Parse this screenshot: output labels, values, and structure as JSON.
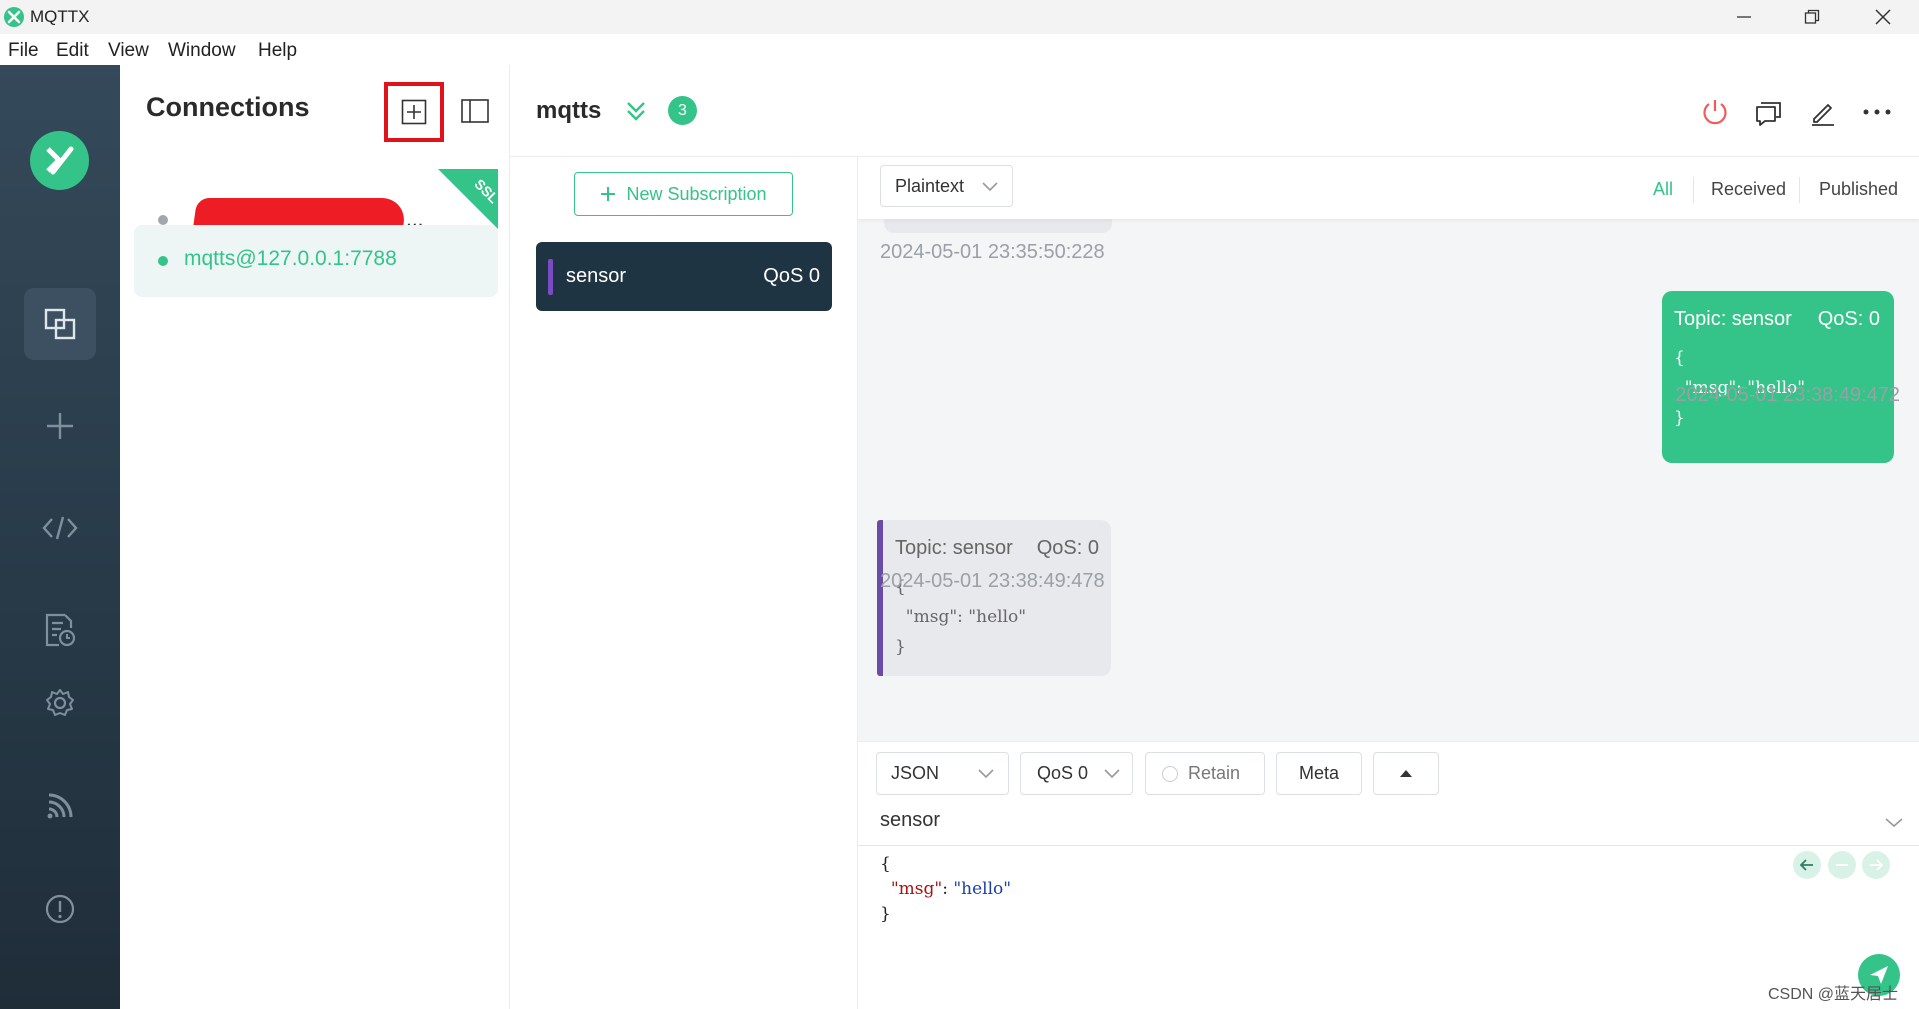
{
  "window": {
    "title": "MQTTX"
  },
  "menu": [
    "File",
    "Edit",
    "View",
    "Window",
    "Help"
  ],
  "connections": {
    "title": "Connections",
    "items": [
      {
        "label": "...",
        "status": "disconnected",
        "ssl_badge": "SSL"
      },
      {
        "label": "mqtts@127.0.0.1:7788",
        "status": "connected"
      }
    ]
  },
  "header": {
    "connection_name": "mqtts",
    "badge_count": "3"
  },
  "subscriptions": {
    "new_button": "New Subscription",
    "items": [
      {
        "topic": "sensor",
        "qos": "QoS 0"
      }
    ]
  },
  "messages": {
    "format": "Plaintext",
    "filters": [
      "All",
      "Received",
      "Published"
    ],
    "active_filter": "All",
    "list": [
      {
        "type": "timestamp-only",
        "time": "2024-05-01 23:35:50:228"
      },
      {
        "type": "published",
        "topic": "Topic: sensor",
        "qos": "QoS: 0",
        "payload": "{\n  \"msg\": \"hello\"\n}",
        "time": "2024-05-01 23:38:49:472"
      },
      {
        "type": "received",
        "topic": "Topic: sensor",
        "qos": "QoS: 0",
        "payload": "{\n  \"msg\": \"hello\"\n}",
        "time": "2024-05-01 23:38:49:478"
      }
    ]
  },
  "publish": {
    "format": "JSON",
    "qos": "QoS 0",
    "retain_label": "Retain",
    "meta_label": "Meta",
    "topic": "sensor",
    "payload": {
      "open": "{",
      "key": "\"msg\"",
      "sep": ": ",
      "value": "\"hello\"",
      "close": "}"
    }
  },
  "watermark": "CSDN @蓝天居士",
  "colors": {
    "accent": "#34c388",
    "nav_bg": "#2c3e4e",
    "sub_item_bg": "#1f3443",
    "highlight": "#e0131b",
    "received_bar": "#6b4ba8"
  }
}
